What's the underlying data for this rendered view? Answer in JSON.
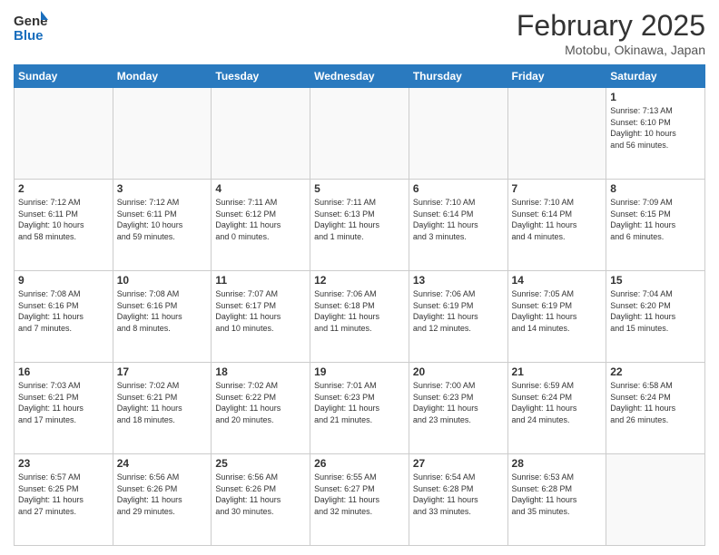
{
  "header": {
    "logo_line1": "General",
    "logo_line2": "Blue",
    "month": "February 2025",
    "location": "Motobu, Okinawa, Japan"
  },
  "weekdays": [
    "Sunday",
    "Monday",
    "Tuesday",
    "Wednesday",
    "Thursday",
    "Friday",
    "Saturday"
  ],
  "weeks": [
    [
      {
        "day": "",
        "info": ""
      },
      {
        "day": "",
        "info": ""
      },
      {
        "day": "",
        "info": ""
      },
      {
        "day": "",
        "info": ""
      },
      {
        "day": "",
        "info": ""
      },
      {
        "day": "",
        "info": ""
      },
      {
        "day": "1",
        "info": "Sunrise: 7:13 AM\nSunset: 6:10 PM\nDaylight: 10 hours\nand 56 minutes."
      }
    ],
    [
      {
        "day": "2",
        "info": "Sunrise: 7:12 AM\nSunset: 6:11 PM\nDaylight: 10 hours\nand 58 minutes."
      },
      {
        "day": "3",
        "info": "Sunrise: 7:12 AM\nSunset: 6:11 PM\nDaylight: 10 hours\nand 59 minutes."
      },
      {
        "day": "4",
        "info": "Sunrise: 7:11 AM\nSunset: 6:12 PM\nDaylight: 11 hours\nand 0 minutes."
      },
      {
        "day": "5",
        "info": "Sunrise: 7:11 AM\nSunset: 6:13 PM\nDaylight: 11 hours\nand 1 minute."
      },
      {
        "day": "6",
        "info": "Sunrise: 7:10 AM\nSunset: 6:14 PM\nDaylight: 11 hours\nand 3 minutes."
      },
      {
        "day": "7",
        "info": "Sunrise: 7:10 AM\nSunset: 6:14 PM\nDaylight: 11 hours\nand 4 minutes."
      },
      {
        "day": "8",
        "info": "Sunrise: 7:09 AM\nSunset: 6:15 PM\nDaylight: 11 hours\nand 6 minutes."
      }
    ],
    [
      {
        "day": "9",
        "info": "Sunrise: 7:08 AM\nSunset: 6:16 PM\nDaylight: 11 hours\nand 7 minutes."
      },
      {
        "day": "10",
        "info": "Sunrise: 7:08 AM\nSunset: 6:16 PM\nDaylight: 11 hours\nand 8 minutes."
      },
      {
        "day": "11",
        "info": "Sunrise: 7:07 AM\nSunset: 6:17 PM\nDaylight: 11 hours\nand 10 minutes."
      },
      {
        "day": "12",
        "info": "Sunrise: 7:06 AM\nSunset: 6:18 PM\nDaylight: 11 hours\nand 11 minutes."
      },
      {
        "day": "13",
        "info": "Sunrise: 7:06 AM\nSunset: 6:19 PM\nDaylight: 11 hours\nand 12 minutes."
      },
      {
        "day": "14",
        "info": "Sunrise: 7:05 AM\nSunset: 6:19 PM\nDaylight: 11 hours\nand 14 minutes."
      },
      {
        "day": "15",
        "info": "Sunrise: 7:04 AM\nSunset: 6:20 PM\nDaylight: 11 hours\nand 15 minutes."
      }
    ],
    [
      {
        "day": "16",
        "info": "Sunrise: 7:03 AM\nSunset: 6:21 PM\nDaylight: 11 hours\nand 17 minutes."
      },
      {
        "day": "17",
        "info": "Sunrise: 7:02 AM\nSunset: 6:21 PM\nDaylight: 11 hours\nand 18 minutes."
      },
      {
        "day": "18",
        "info": "Sunrise: 7:02 AM\nSunset: 6:22 PM\nDaylight: 11 hours\nand 20 minutes."
      },
      {
        "day": "19",
        "info": "Sunrise: 7:01 AM\nSunset: 6:23 PM\nDaylight: 11 hours\nand 21 minutes."
      },
      {
        "day": "20",
        "info": "Sunrise: 7:00 AM\nSunset: 6:23 PM\nDaylight: 11 hours\nand 23 minutes."
      },
      {
        "day": "21",
        "info": "Sunrise: 6:59 AM\nSunset: 6:24 PM\nDaylight: 11 hours\nand 24 minutes."
      },
      {
        "day": "22",
        "info": "Sunrise: 6:58 AM\nSunset: 6:24 PM\nDaylight: 11 hours\nand 26 minutes."
      }
    ],
    [
      {
        "day": "23",
        "info": "Sunrise: 6:57 AM\nSunset: 6:25 PM\nDaylight: 11 hours\nand 27 minutes."
      },
      {
        "day": "24",
        "info": "Sunrise: 6:56 AM\nSunset: 6:26 PM\nDaylight: 11 hours\nand 29 minutes."
      },
      {
        "day": "25",
        "info": "Sunrise: 6:56 AM\nSunset: 6:26 PM\nDaylight: 11 hours\nand 30 minutes."
      },
      {
        "day": "26",
        "info": "Sunrise: 6:55 AM\nSunset: 6:27 PM\nDaylight: 11 hours\nand 32 minutes."
      },
      {
        "day": "27",
        "info": "Sunrise: 6:54 AM\nSunset: 6:28 PM\nDaylight: 11 hours\nand 33 minutes."
      },
      {
        "day": "28",
        "info": "Sunrise: 6:53 AM\nSunset: 6:28 PM\nDaylight: 11 hours\nand 35 minutes."
      },
      {
        "day": "",
        "info": ""
      }
    ]
  ]
}
